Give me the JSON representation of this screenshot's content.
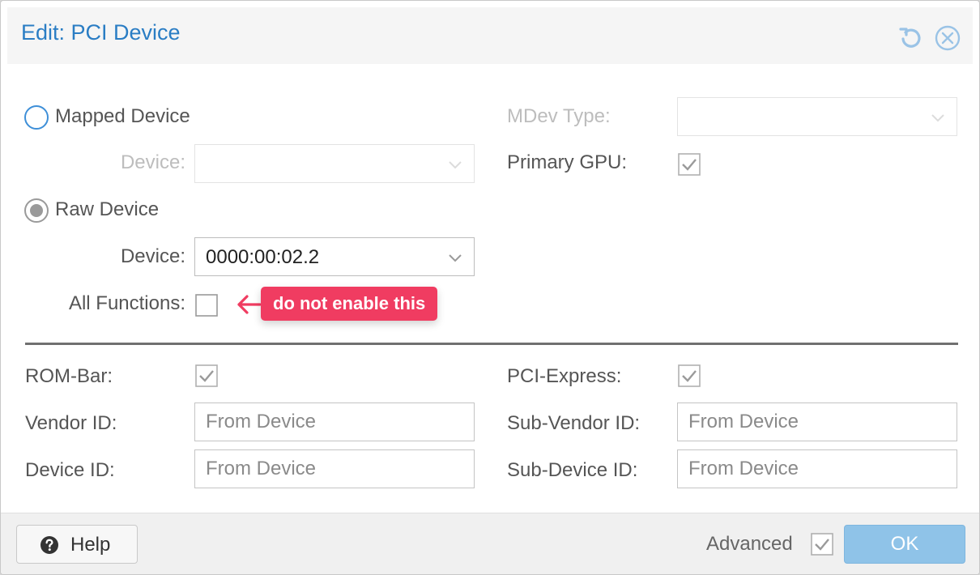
{
  "dialog": {
    "title": "Edit: PCI Device"
  },
  "form": {
    "mapped_device_label": "Mapped Device",
    "mapped_device_selector_label": "Device:",
    "raw_device_label": "Raw Device",
    "raw_device_selector_label": "Device:",
    "raw_device_value": "0000:00:02.2",
    "all_functions_label": "All Functions:",
    "mdev_type_label": "MDev Type:",
    "primary_gpu_label": "Primary GPU:",
    "rom_bar_label": "ROM-Bar:",
    "pci_express_label": "PCI-Express:",
    "vendor_id_label": "Vendor ID:",
    "vendor_id_placeholder": "From Device",
    "device_id_label": "Device ID:",
    "device_id_placeholder": "From Device",
    "sub_vendor_id_label": "Sub-Vendor ID:",
    "sub_vendor_id_placeholder": "From Device",
    "sub_device_id_label": "Sub-Device ID:",
    "sub_device_id_placeholder": "From Device",
    "selected_mode": "raw",
    "all_functions_checked": false,
    "primary_gpu_checked": true,
    "rom_bar_checked": true,
    "pci_express_checked": true
  },
  "annotation": {
    "text": "do not enable this",
    "color": "#f03c61"
  },
  "footer": {
    "help_label": "Help",
    "advanced_label": "Advanced",
    "advanced_checked": true,
    "ok_label": "OK"
  },
  "colors": {
    "title": "#2a7dc4",
    "radio_unselected_border": "#3e8fd8",
    "ok_button": "#8fc3e8"
  }
}
